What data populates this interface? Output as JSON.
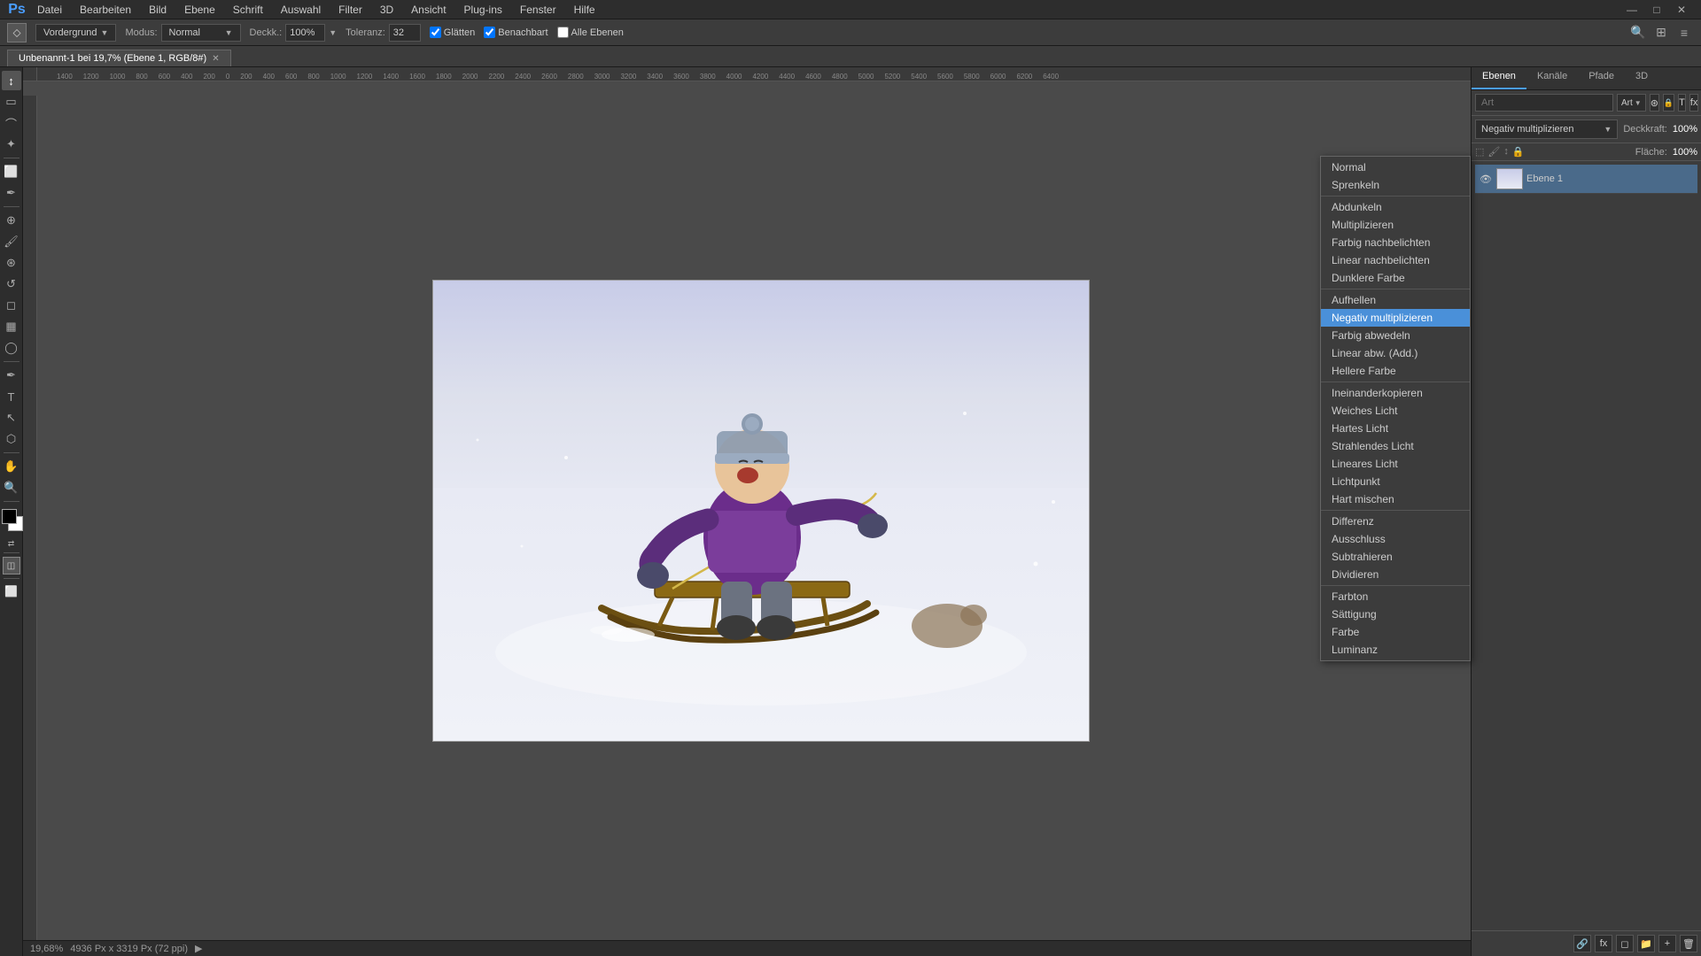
{
  "app": {
    "title": "Adobe Photoshop",
    "icon": "Ps"
  },
  "window_controls": {
    "minimize": "—",
    "maximize": "□",
    "close": "✕"
  },
  "menu_bar": {
    "items": [
      "Datei",
      "Bearbeiten",
      "Bild",
      "Ebene",
      "Schrift",
      "Auswahl",
      "Filter",
      "3D",
      "Ansicht",
      "Plug-ins",
      "Fenster",
      "Hilfe"
    ]
  },
  "options_bar": {
    "tool_icon": "🖌",
    "mode_label": "Modus:",
    "mode_value": "Normal",
    "opacity_label": "Deckk.:",
    "opacity_value": "100%",
    "tolerance_label": "Toleranz:",
    "tolerance_value": "32",
    "glatten_label": "Glätten",
    "benachbart_label": "Benachbart",
    "alle_ebenen_label": "Alle Ebenen",
    "vordergrund_label": "Vordergrund",
    "vordergrund_value": "Vordergrund"
  },
  "tab": {
    "name": "Unbenannt-1 bei 19,7% (Ebene 1, RGB/8#)",
    "modified": true,
    "close": "✕"
  },
  "canvas": {
    "zoom": "19,68%",
    "size": "4936 Px x 3319 Px (72 ppi)"
  },
  "status_bar": {
    "zoom": "19,68%",
    "dimensions": "4936 Px x 3319 Px (72 ppi)",
    "arrow": "▶"
  },
  "right_panel": {
    "tabs": [
      "Ebenen",
      "Kanäle",
      "Pfade",
      "3D"
    ]
  },
  "layers_panel": {
    "search_placeholder": "Art",
    "blend_mode": "Negativ multiplizieren",
    "opacity_label": "Deckkraft:",
    "opacity_value": "100%",
    "fill_label": "Fläche:",
    "fill_value": "100%"
  },
  "blend_dropdown": {
    "groups": [
      {
        "items": [
          "Normal",
          "Sprenkeln"
        ]
      },
      {
        "items": [
          "Abdunkeln",
          "Multiplizieren",
          "Farbig nachbelichten",
          "Linear nachbelichten",
          "Dunklere Farbe"
        ]
      },
      {
        "items": [
          "Aufhellen",
          "Negativ multiplizieren",
          "Farbig abwedeln",
          "Linear abw. (Add.)",
          "Hellere Farbe"
        ]
      },
      {
        "items": [
          "Ineinanderkopieren",
          "Weiches Licht",
          "Hartes Licht",
          "Strahlendes Licht",
          "Lineares Licht",
          "Lichtpunkt",
          "Hart mischen"
        ]
      },
      {
        "items": [
          "Differenz",
          "Ausschluss",
          "Subtrahieren",
          "Dividieren"
        ]
      },
      {
        "items": [
          "Farbton",
          "Sättigung",
          "Farbe",
          "Luminanz"
        ]
      }
    ],
    "selected": "Negativ multiplizieren"
  },
  "tools": {
    "items": [
      "↕",
      "🔲",
      "⊕",
      "✏",
      "🖌",
      "🔍",
      "✂",
      "🖊",
      "T",
      "⬡",
      "⬣",
      "🗒",
      "🔢",
      "💉",
      "🎯",
      "✋",
      "🔍"
    ]
  },
  "bottom_bar": {
    "left_icon": "⚡",
    "right_icon": "⚡"
  }
}
